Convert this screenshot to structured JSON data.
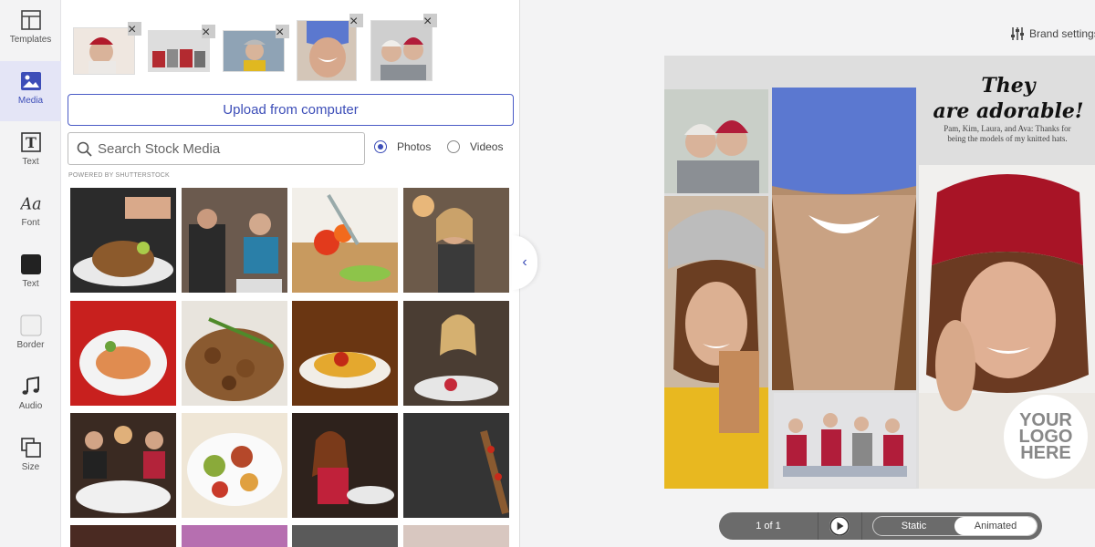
{
  "nav": {
    "items": [
      {
        "label": "Templates",
        "icon": "templates-icon"
      },
      {
        "label": "Media",
        "icon": "media-icon",
        "active": true
      },
      {
        "label": "Text",
        "icon": "text-icon"
      },
      {
        "label": "Font",
        "icon": "font-icon"
      },
      {
        "label": "Text",
        "icon": "text-color-icon",
        "swatch": "#222222"
      },
      {
        "label": "Border",
        "icon": "border-color-icon",
        "swatch": "#f0f0f0"
      },
      {
        "label": "Audio",
        "icon": "music-note-icon"
      },
      {
        "label": "Size",
        "icon": "size-icon"
      }
    ]
  },
  "media": {
    "upload_label": "Upload from computer",
    "search_placeholder": "Search Stock Media",
    "radio_photos": "Photos",
    "radio_videos": "Videos",
    "selected_type": "Photos",
    "powered_by": "POWERED BY SHUTTERSTOCK",
    "remove_glyph": "×"
  },
  "collapse_glyph": "‹",
  "brand_settings": "Brand settings",
  "canvas": {
    "title_line1": "They",
    "title_line2": "are adorable!",
    "caption": "Pam, Kim, Laura, and Ava: Thanks for being the models of my knitted hats.",
    "logo_lines": [
      "YOUR",
      "LOGO",
      "HERE"
    ]
  },
  "controls": {
    "page_indicator": "1 of 1",
    "static_label": "Static",
    "animated_label": "Animated",
    "selected_mode": "Animated"
  },
  "colors": {
    "accent": "#3d4eb8",
    "active_nav_bg": "#e4e5f6",
    "pager_bg": "#6b6b6b"
  }
}
